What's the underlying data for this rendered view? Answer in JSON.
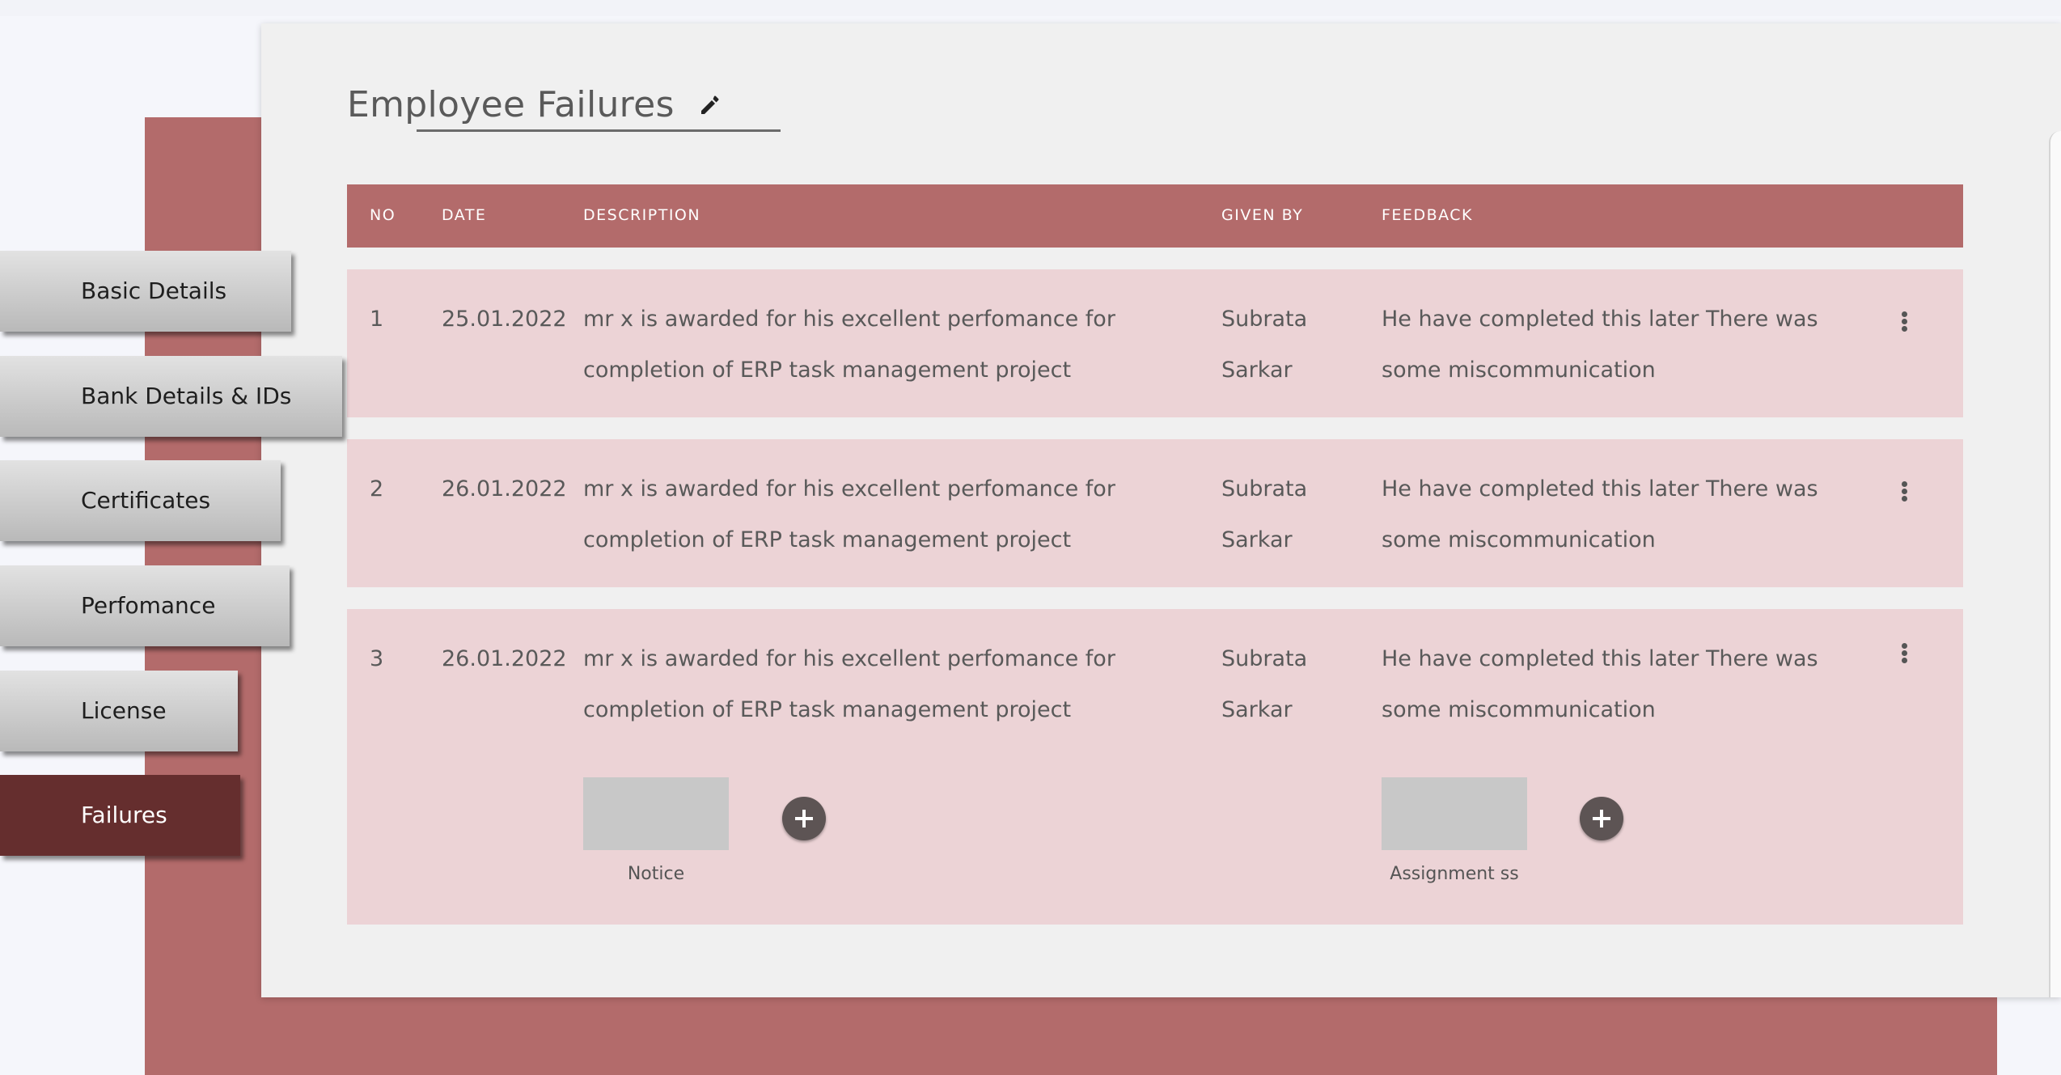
{
  "page": {
    "title": "Employee Failures"
  },
  "sidebar": {
    "tabs": [
      {
        "label": "Basic Details",
        "active": false
      },
      {
        "label": "Bank Details & IDs",
        "active": false
      },
      {
        "label": "Certificates",
        "active": false
      },
      {
        "label": "Perfomance",
        "active": false
      },
      {
        "label": "License",
        "active": false
      },
      {
        "label": "Failures",
        "active": true
      }
    ]
  },
  "table": {
    "headers": {
      "no": "NO",
      "date": "DATE",
      "description": "DESCRIPTION",
      "given_by": "GIVEN BY",
      "feedback": "FEEDBACK"
    },
    "rows": [
      {
        "no": "1",
        "date": "25.01.2022",
        "description": "mr x is awarded for his excellent perfomance for\ncompletion of ERP task management project",
        "given_by": "Subrata\nSarkar",
        "feedback": "He have completed this later There was\nsome miscommunication"
      },
      {
        "no": "2",
        "date": "26.01.2022",
        "description": "mr x is awarded for his excellent perfomance for\ncompletion of ERP task management project",
        "given_by": "Subrata\nSarkar",
        "feedback": "He have completed this later There was\nsome miscommunication"
      },
      {
        "no": "3",
        "date": "26.01.2022",
        "description": "mr x is awarded for his excellent perfomance for\ncompletion of ERP task management project",
        "given_by": "Subrata\nSarkar",
        "feedback": "He have completed this later There was\nsome miscommunication"
      }
    ],
    "attachments": {
      "notice_label": "Notice",
      "assignment_label": "Assignment ss"
    }
  },
  "icons": {
    "edit": "pencil-icon",
    "row_menu": "more-vertical-icon",
    "add": "plus-icon"
  },
  "colors": {
    "accent": "#b36b6b",
    "row_bg": "#ecd3d6",
    "active_tab": "#652e2e",
    "card_bg": "#f0f0f0"
  }
}
